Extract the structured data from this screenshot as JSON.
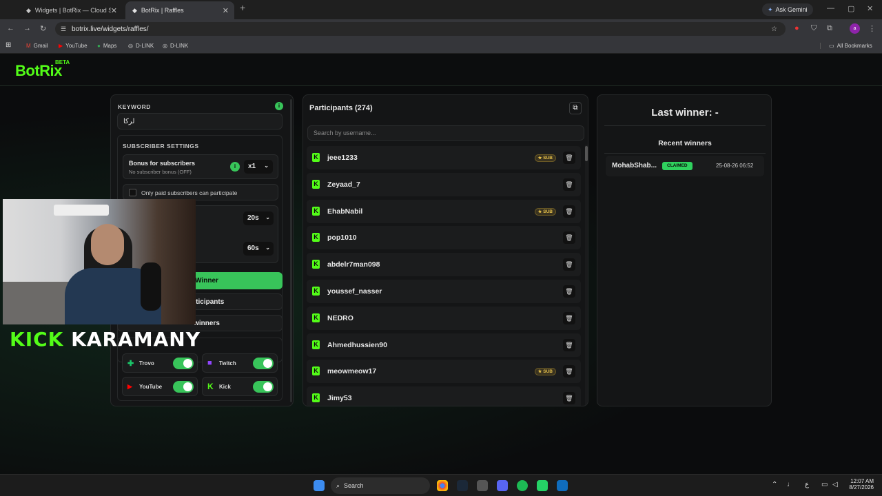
{
  "browser": {
    "tabs": [
      {
        "title": "Widgets | BotRix — Cloud Strea",
        "active": false
      },
      {
        "title": "BotRix | Raffles",
        "active": true
      }
    ],
    "new_tab": "+",
    "ask_gemini": "Ask Gemini",
    "url": "botrix.live/widgets/raffles/",
    "bookmarks": [
      "Gmail",
      "YouTube",
      "Maps",
      "D-LINK",
      "D-LINK"
    ],
    "all_bookmarks": "All Bookmarks",
    "profile_initial": "a"
  },
  "app": {
    "logo": "BotRix",
    "logo_badge": "BETA"
  },
  "settings": {
    "keyword_label": "KEYWORD",
    "keyword_value": "لركا",
    "subscriber_settings_label": "SUBSCRIBER SETTINGS",
    "bonus_title": "Bonus for subscribers",
    "bonus_sub": "No subscriber bonus (OFF)",
    "bonus_multiplier": "x1",
    "paid_only": "Only paid subscribers can participate",
    "timer_1": "20s",
    "timer_2": "60s",
    "pick_winner": "Winner",
    "clear_participants": "articipants",
    "clear_winners": "winners",
    "platforms": [
      {
        "name": "Trovo",
        "enabled": true,
        "color": "#1ac86a"
      },
      {
        "name": "Twitch",
        "enabled": true,
        "color": "#9146ff"
      },
      {
        "name": "YouTube",
        "enabled": true,
        "color": "#ff0000"
      },
      {
        "name": "Kick",
        "enabled": true,
        "color": "#53fc18"
      }
    ]
  },
  "participants": {
    "title": "Participants (274)",
    "search_placeholder": "Search by username...",
    "sub_badge": "SUB",
    "list": [
      {
        "name": "jeee1233",
        "sub": true
      },
      {
        "name": "Zeyaad_7",
        "sub": false
      },
      {
        "name": "EhabNabil",
        "sub": true
      },
      {
        "name": "pop1010",
        "sub": false
      },
      {
        "name": "abdelr7man098",
        "sub": false
      },
      {
        "name": "youssef_nasser",
        "sub": false
      },
      {
        "name": "NEDRO",
        "sub": false
      },
      {
        "name": "Ahmedhussien90",
        "sub": false
      },
      {
        "name": "meowmeow17",
        "sub": true
      },
      {
        "name": "Jimy53",
        "sub": false
      }
    ]
  },
  "winners": {
    "last_winner": "Last winner: -",
    "recent_title": "Recent winners",
    "recent": [
      {
        "name": "MohabShab...",
        "status": "CLAIMED",
        "date": "25-08-26 06:52"
      }
    ]
  },
  "overlay": {
    "streamer_text_1": "KICK",
    "streamer_text_2": "KARAMANY"
  },
  "taskbar": {
    "search": "Search",
    "time": "12:07 AM",
    "date": "8/27/2026",
    "lang": "ع"
  },
  "colors": {
    "accent": "#53fc18",
    "toggle": "#38c45a",
    "claimed": "#2fd15e"
  }
}
